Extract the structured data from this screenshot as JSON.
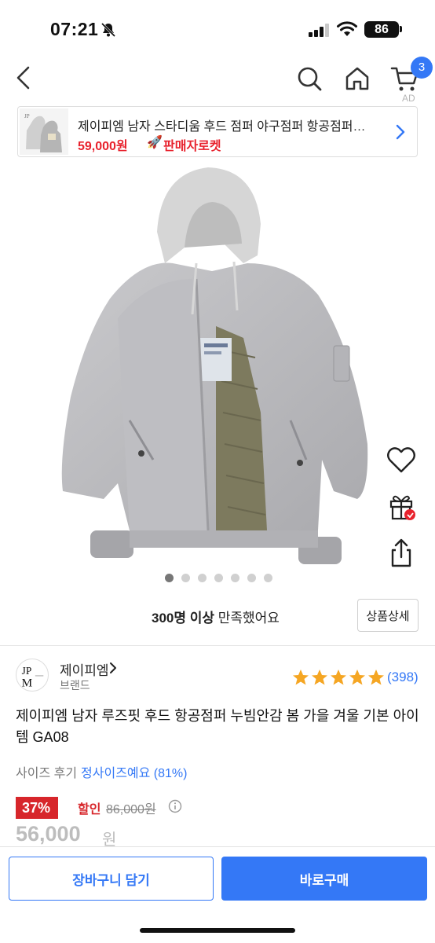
{
  "status_bar": {
    "time": "07:21",
    "battery": "86"
  },
  "nav": {
    "cart_count": "3",
    "ad_mark": "AD"
  },
  "ad": {
    "title": "제이피엠 남자 스타디움 후드 점퍼 야구점퍼 항공점퍼…",
    "price": "59,000원",
    "rocket_label": "판매자로켓"
  },
  "gallery": {
    "total_images": 7,
    "active_index": 0
  },
  "satisfaction": {
    "count_text": "300명 이상",
    "suffix": " 만족했어요",
    "detail_label": "상품상세"
  },
  "brand": {
    "name": "제이피엠",
    "sub_label": "브랜드"
  },
  "rating": {
    "stars": 5,
    "review_count": "(398)"
  },
  "product": {
    "title": "제이피엠 남자 루즈핏 후드 항공점퍼 누빔안감 봄 가을 겨울 기본 아이템 GA08",
    "size_review_label": "사이즈 후기",
    "size_review_value": "정사이즈예요 (81%)",
    "discount_rate": "37%",
    "discount_label": "할인",
    "original_price": "86,000원",
    "sale_price": "56,000",
    "sale_price_unit": "원"
  },
  "actions": {
    "cart_label": "장바구니 담기",
    "buy_label": "바로구매"
  },
  "colors": {
    "accent": "#3478f6",
    "sale_red": "#d7262b",
    "star": "#f5a623"
  }
}
